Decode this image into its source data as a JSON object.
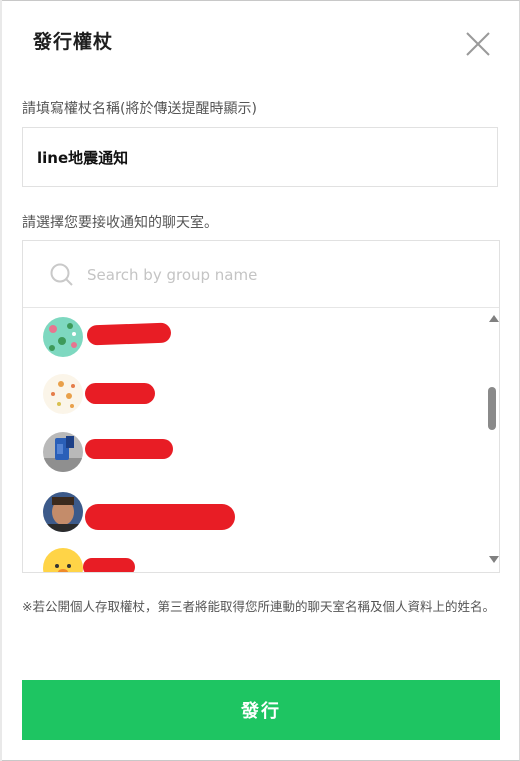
{
  "dialog": {
    "title": "發行權杖",
    "close_icon": "close-icon"
  },
  "token_name": {
    "label": "請填寫權杖名稱(將於傳送提醒時顯示)",
    "value": "line地震通知"
  },
  "chatroom": {
    "label": "請選擇您要接收通知的聊天室。",
    "search": {
      "placeholder": "Search by group name",
      "icon": "search-icon"
    },
    "groups": [
      {
        "name": "",
        "avatar": "green-pattern-avatar",
        "redacted": true
      },
      {
        "name": "",
        "avatar": "cream-pattern-avatar",
        "redacted": true
      },
      {
        "name": "",
        "avatar": "blue-object-avatar",
        "redacted": true
      },
      {
        "name": "",
        "avatar": "person-portrait-avatar",
        "redacted": true
      },
      {
        "name": "",
        "avatar": "yellow-character-avatar",
        "redacted": true
      }
    ],
    "scrollbar": {
      "thumb_position": 0.3
    }
  },
  "notice": "※若公開個人存取權杖，第三者將能取得您所連動的聊天室名稱及個人資料上的姓名。",
  "publish_button": {
    "label": "發行"
  },
  "colors": {
    "accent": "#1ec562",
    "redaction": "#e81d25"
  }
}
